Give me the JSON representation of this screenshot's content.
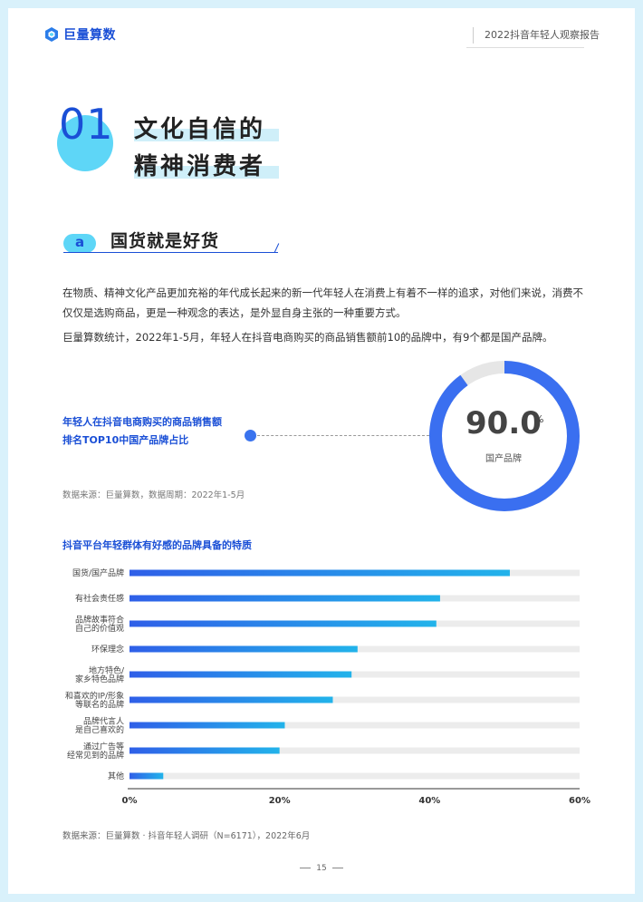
{
  "header": {
    "logo_text": "巨量算数",
    "report_title": "2022抖音年轻人观察报告"
  },
  "section": {
    "number": "01",
    "title_line1": "文化自信的",
    "title_line2": "精神消费者"
  },
  "subsection": {
    "letter": "a",
    "title": "国货就是好货"
  },
  "paragraphs": [
    "在物质、精神文化产品更加充裕的年代成长起来的新一代年轻人在消费上有着不一样的追求，对他们来说，消费不仅仅是选购商品，更是一种观念的表达，是外显自身主张的一种重要方式。",
    "巨量算数统计，2022年1-5月，年轻人在抖音电商购买的商品销售额前10的品牌中，有9个都是国产品牌。"
  ],
  "donut": {
    "label_line1": "年轻人在抖音电商购买的商品销售额",
    "label_line2": "排名TOP10中国产品牌占比",
    "value": "90.0",
    "unit": "%",
    "sublabel": "国产品牌",
    "fraction": 0.9,
    "colors": {
      "fill": "#3a6ff0",
      "track": "#e6e6e6"
    },
    "source": "数据来源：巨量算数，数据周期：2022年1-5月"
  },
  "chart_data": {
    "type": "bar",
    "orientation": "horizontal",
    "title": "抖音平台年轻群体有好感的品牌具备的特质",
    "categories": [
      [
        "国货/国产品牌"
      ],
      [
        "有社会责任感"
      ],
      [
        "品牌故事符合",
        "自己的价值观"
      ],
      [
        "环保理念"
      ],
      [
        "地方特色/",
        "家乡特色品牌"
      ],
      [
        "和喜欢的IP/形象",
        "等联名的品牌"
      ],
      [
        "品牌代言人",
        "是自己喜欢的"
      ],
      [
        "通过广告等",
        "经常见到的品牌"
      ],
      [
        "其他"
      ]
    ],
    "values": [
      50.7,
      41.4,
      40.9,
      30.4,
      29.6,
      27.1,
      20.7,
      20.0,
      4.5
    ],
    "xlim": [
      0,
      60
    ],
    "x_ticks": [
      "0%",
      "20%",
      "40%",
      "60%"
    ],
    "colors": {
      "bar_start": "#2f5fe8",
      "bar_end": "#22b3ea",
      "track": "#ececec"
    },
    "source": "数据来源：巨量算数 · 抖音年轻人调研（N=6171），2022年6月"
  },
  "footer": {
    "page_number": "15"
  }
}
